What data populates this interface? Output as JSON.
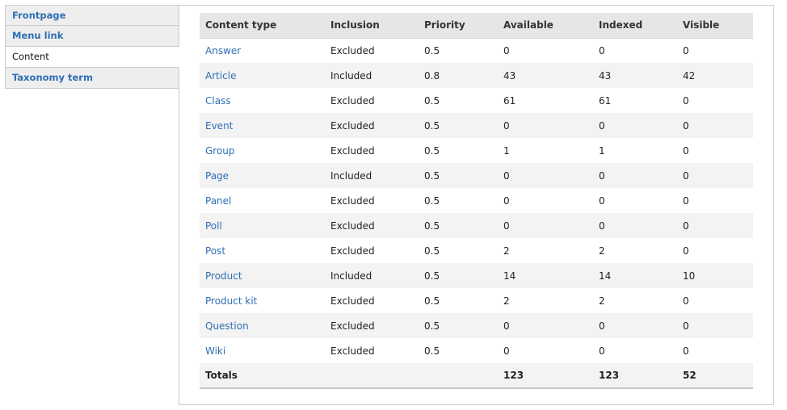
{
  "tabs": [
    {
      "label": "Frontpage",
      "active": false
    },
    {
      "label": "Menu link",
      "active": false
    },
    {
      "label": "Content",
      "active": true
    },
    {
      "label": "Taxonomy term",
      "active": false
    }
  ],
  "table": {
    "headers": [
      "Content type",
      "Inclusion",
      "Priority",
      "Available",
      "Indexed",
      "Visible"
    ],
    "rows": [
      [
        "Answer",
        "Excluded",
        "0.5",
        "0",
        "0",
        "0"
      ],
      [
        "Article",
        "Included",
        "0.8",
        "43",
        "43",
        "42"
      ],
      [
        "Class",
        "Excluded",
        "0.5",
        "61",
        "61",
        "0"
      ],
      [
        "Event",
        "Excluded",
        "0.5",
        "0",
        "0",
        "0"
      ],
      [
        "Group",
        "Excluded",
        "0.5",
        "1",
        "1",
        "0"
      ],
      [
        "Page",
        "Included",
        "0.5",
        "0",
        "0",
        "0"
      ],
      [
        "Panel",
        "Excluded",
        "0.5",
        "0",
        "0",
        "0"
      ],
      [
        "Poll",
        "Excluded",
        "0.5",
        "0",
        "0",
        "0"
      ],
      [
        "Post",
        "Excluded",
        "0.5",
        "2",
        "2",
        "0"
      ],
      [
        "Product",
        "Included",
        "0.5",
        "14",
        "14",
        "10"
      ],
      [
        "Product kit",
        "Excluded",
        "0.5",
        "2",
        "2",
        "0"
      ],
      [
        "Question",
        "Excluded",
        "0.5",
        "0",
        "0",
        "0"
      ],
      [
        "Wiki",
        "Excluded",
        "0.5",
        "0",
        "0",
        "0"
      ]
    ],
    "totals": {
      "label": "Totals",
      "inclusion": "",
      "priority": "",
      "available": "123",
      "indexed": "123",
      "visible": "52"
    }
  },
  "colors": {
    "link": "#2f6eb5",
    "header_bg": "#e6e6e6",
    "stripe": "#f3f3f3",
    "tab_bg": "#eeeeee"
  }
}
